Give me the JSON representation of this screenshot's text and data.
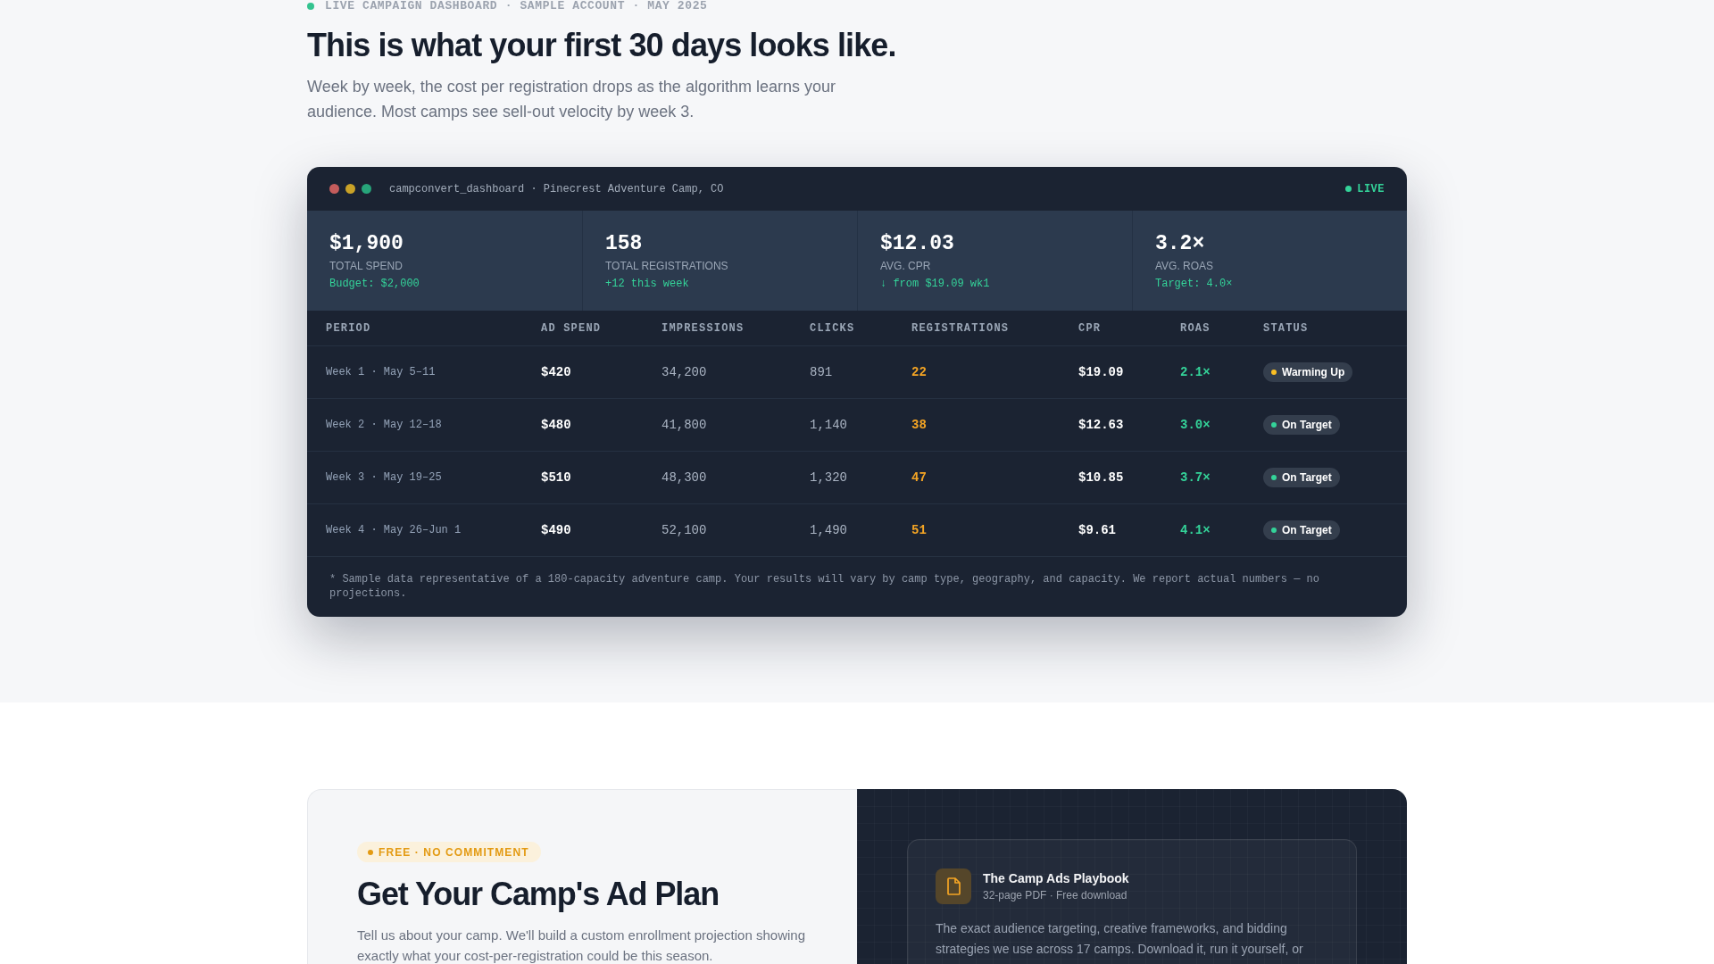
{
  "hero": {
    "eyebrow": "LIVE CAMPAIGN DASHBOARD · SAMPLE ACCOUNT · MAY 2025",
    "title": "This is what your first 30 days looks like.",
    "subtitle": "Week by week, the cost per registration drops as the algorithm learns your audience. Most camps see sell-out velocity by week 3."
  },
  "dashboard": {
    "window_title": "campconvert_dashboard · Pinecrest Adventure Camp, CO",
    "live_label": "LIVE",
    "stats": [
      {
        "value": "$1,900",
        "label": "TOTAL SPEND",
        "note": "Budget: $2,000"
      },
      {
        "value": "158",
        "label": "TOTAL REGISTRATIONS",
        "note": "+12 this week"
      },
      {
        "value": "$12.03",
        "label": "AVG. CPR",
        "note": "↓ from $19.09 wk1"
      },
      {
        "value": "3.2×",
        "label": "AVG. ROAS",
        "note": "Target: 4.0×"
      }
    ],
    "table": {
      "columns": [
        "PERIOD",
        "AD SPEND",
        "IMPRESSIONS",
        "CLICKS",
        "REGISTRATIONS",
        "CPR",
        "ROAS",
        "STATUS"
      ],
      "rows": [
        {
          "period": "Week 1 · May 5–11",
          "ad_spend": "$420",
          "impressions": "34,200",
          "clicks": "891",
          "registrations": "22",
          "cpr": "$19.09",
          "roas": "2.1×",
          "status": {
            "label": "Warming Up",
            "color": "#fbbf24"
          }
        },
        {
          "period": "Week 2 · May 12–18",
          "ad_spend": "$480",
          "impressions": "41,800",
          "clicks": "1,140",
          "registrations": "38",
          "cpr": "$12.63",
          "roas": "3.0×",
          "status": {
            "label": "On Target",
            "color": "#34d399"
          }
        },
        {
          "period": "Week 3 · May 19–25",
          "ad_spend": "$510",
          "impressions": "48,300",
          "clicks": "1,320",
          "registrations": "47",
          "cpr": "$10.85",
          "roas": "3.7×",
          "status": {
            "label": "On Target",
            "color": "#34d399"
          }
        },
        {
          "period": "Week 4 · May 26–Jun 1",
          "ad_spend": "$490",
          "impressions": "52,100",
          "clicks": "1,490",
          "registrations": "51",
          "cpr": "$9.61",
          "roas": "4.1×",
          "status": {
            "label": "On Target",
            "color": "#34d399"
          }
        }
      ]
    },
    "footnote": "* Sample data representative of a 180-capacity adventure camp. Your results will vary by camp type, geography, and capacity. We report actual numbers — no projections."
  },
  "offer": {
    "tag": "FREE · NO COMMITMENT",
    "title": "Get Your Camp's Ad Plan",
    "description": "Tell us about your camp. We'll build a custom enrollment projection showing exactly what your cost-per-registration could be this season.",
    "playbook": {
      "title": "The Camp Ads Playbook",
      "subtitle": "32-page PDF · Free download",
      "description": "The exact audience targeting, creative frameworks, and bidding strategies we use across 17 camps. Download it, run it yourself, or"
    }
  }
}
